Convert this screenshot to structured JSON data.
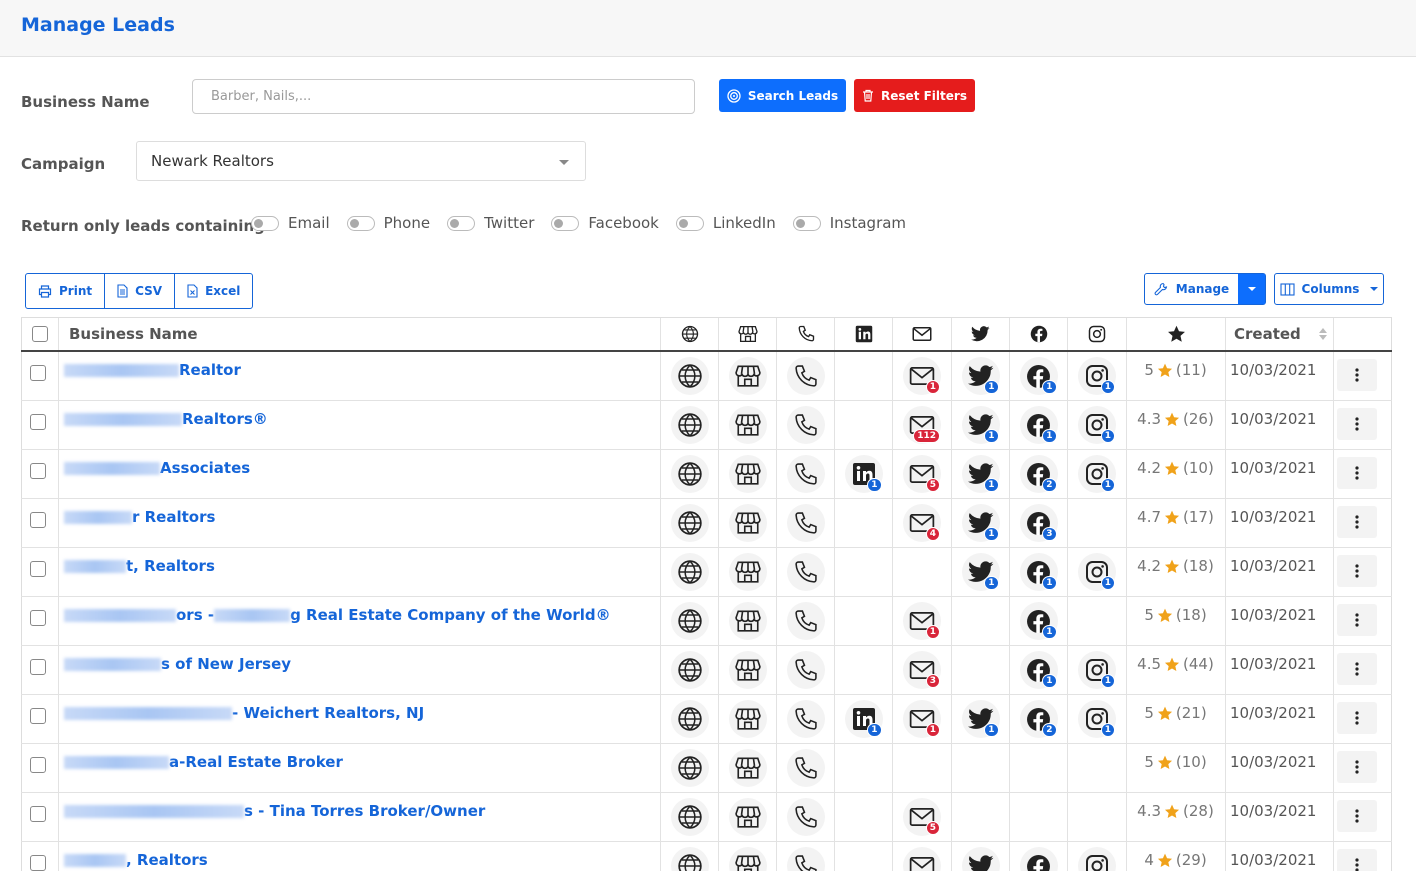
{
  "page": {
    "title": "Manage Leads"
  },
  "form": {
    "business_name_label": "Business Name",
    "business_name_placeholder": "Barber, Nails,...",
    "search_label": "Search Leads",
    "reset_label": "Reset Filters",
    "campaign_label": "Campaign",
    "campaign_value": "Newark Realtors",
    "return_label": "Return only leads containing",
    "filters": [
      "Email",
      "Phone",
      "Twitter",
      "Facebook",
      "LinkedIn",
      "Instagram"
    ]
  },
  "toolbar": {
    "print_label": "Print",
    "csv_label": "CSV",
    "excel_label": "Excel",
    "manage_label": "Manage",
    "columns_label": "Columns"
  },
  "table": {
    "header_name": "Business Name",
    "header_created": "Created",
    "icon_columns": [
      "globe-icon",
      "storefront-icon",
      "phone-icon",
      "linkedin-icon",
      "envelope-icon",
      "twitter-icon",
      "facebook-icon",
      "instagram-icon",
      "star-icon"
    ],
    "rows": [
      {
        "name": "Realtor",
        "linkedin": null,
        "email": "1",
        "twitter": "1",
        "facebook": "1",
        "instagram": "1",
        "rating": "5",
        "reviews": "(11)",
        "created": "10/03/2021"
      },
      {
        "name": "Realtors®",
        "linkedin": null,
        "email": "112",
        "twitter": "1",
        "facebook": "1",
        "instagram": "1",
        "rating": "4.3",
        "reviews": "(26)",
        "created": "10/03/2021"
      },
      {
        "name": "Associates",
        "linkedin": "1",
        "email": "5",
        "twitter": "1",
        "facebook": "2",
        "instagram": "1",
        "rating": "4.2",
        "reviews": "(10)",
        "created": "10/03/2021"
      },
      {
        "name": "r Realtors",
        "linkedin": null,
        "email": "4",
        "twitter": "1",
        "facebook": "3",
        "instagram": null,
        "rating": "4.7",
        "reviews": "(17)",
        "created": "10/03/2021"
      },
      {
        "name": "t, Realtors",
        "linkedin": null,
        "email": null,
        "twitter": "1",
        "facebook": "1",
        "instagram": "1",
        "rating": "4.2",
        "reviews": "(18)",
        "created": "10/03/2021"
      },
      {
        "name": "ors - ",
        "name2": "g Real Estate Company of the World®",
        "linkedin": null,
        "email": "1",
        "twitter": null,
        "facebook": "1",
        "instagram": null,
        "rating": "5",
        "reviews": "(18)",
        "created": "10/03/2021"
      },
      {
        "name": "s of New Jersey",
        "linkedin": null,
        "email": "3",
        "twitter": null,
        "facebook": "1",
        "instagram": "1",
        "rating": "4.5",
        "reviews": "(44)",
        "created": "10/03/2021"
      },
      {
        "name": "- Weichert Realtors, NJ",
        "linkedin": "1",
        "email": "1",
        "twitter": "1",
        "facebook": "2",
        "instagram": "1",
        "rating": "5",
        "reviews": "(21)",
        "created": "10/03/2021"
      },
      {
        "name": "a-Real Estate Broker",
        "linkedin": null,
        "email": null,
        "twitter": null,
        "facebook": null,
        "instagram": null,
        "rating": "5",
        "reviews": "(10)",
        "created": "10/03/2021"
      },
      {
        "name": "s - Tina Torres Broker/Owner",
        "linkedin": null,
        "email": "5",
        "twitter": null,
        "facebook": null,
        "instagram": null,
        "rating": "4.3",
        "reviews": "(28)",
        "created": "10/03/2021"
      },
      {
        "name": ", Realtors",
        "linkedin": null,
        "email": "",
        "twitter": "",
        "facebook": "",
        "instagram": "",
        "rating": "4",
        "reviews": "(29)",
        "created": "10/03/2021"
      }
    ]
  },
  "colors": {
    "brand_blue": "#1565d8",
    "button_blue": "#0d6efd",
    "reset_red": "#e51c1c",
    "badge_red": "#d9253a",
    "star": "#f0a21a"
  }
}
